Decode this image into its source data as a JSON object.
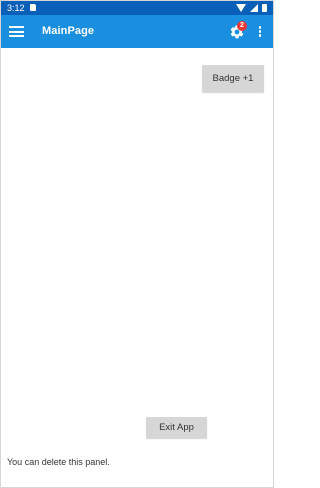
{
  "status_bar": {
    "time": "3:12",
    "sd_icon": "sd-card-icon",
    "wifi_icon": "wifi-icon",
    "signal_icon": "signal-icon",
    "battery_icon": "battery-icon"
  },
  "app_bar": {
    "title": "MainPage",
    "menu_icon": "hamburger-menu-icon",
    "settings_icon": "gear-icon",
    "settings_badge": "2",
    "overflow_icon": "more-vertical-icon"
  },
  "buttons": {
    "badge_label": "Badge +1",
    "exit_label": "Exit App"
  },
  "panel": {
    "text": "You can delete this panel."
  },
  "colors": {
    "status_bar": "#0a60b8",
    "app_bar": "#1a8fe0",
    "badge": "#e53935",
    "button": "#d6d6d6"
  }
}
